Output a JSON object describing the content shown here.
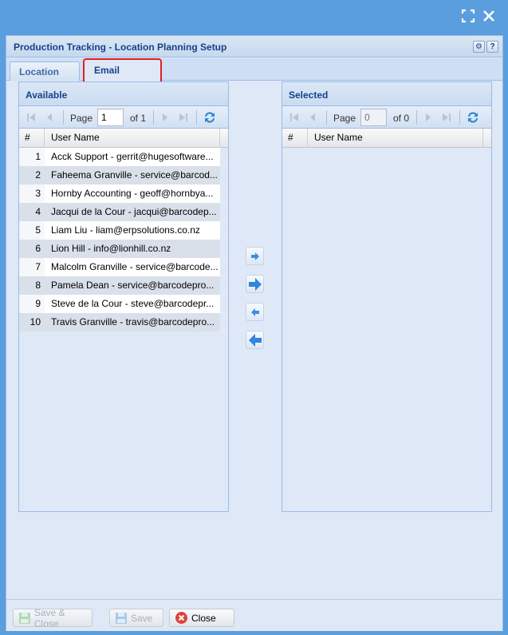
{
  "window": {
    "title": "Production Tracking - Location Planning Setup",
    "tool_gear": "⚙",
    "tool_help": "?"
  },
  "tabs": [
    {
      "label": "Location",
      "active": false
    },
    {
      "label": "Email",
      "active": true
    }
  ],
  "available": {
    "title": "Available",
    "pager": {
      "page_label": "Page",
      "page_value": "1",
      "of_label": "of 1"
    },
    "columns": {
      "num": "#",
      "user": "User Name"
    },
    "rows": [
      {
        "num": "1",
        "name": "Acck Support - gerrit@hugesoftware..."
      },
      {
        "num": "2",
        "name": "Faheema Granville - service@barcod..."
      },
      {
        "num": "3",
        "name": "Hornby Accounting - geoff@hornbya..."
      },
      {
        "num": "4",
        "name": "Jacqui de la Cour - jacqui@barcodep..."
      },
      {
        "num": "5",
        "name": "Liam Liu - liam@erpsolutions.co.nz"
      },
      {
        "num": "6",
        "name": "Lion Hill - info@lionhill.co.nz"
      },
      {
        "num": "7",
        "name": "Malcolm Granville - service@barcode..."
      },
      {
        "num": "8",
        "name": "Pamela Dean - service@barcodepro..."
      },
      {
        "num": "9",
        "name": "Steve de la Cour - steve@barcodepr..."
      },
      {
        "num": "10",
        "name": "Travis Granville - travis@barcodepro..."
      }
    ]
  },
  "selected": {
    "title": "Selected",
    "pager": {
      "page_label": "Page",
      "page_placeholder": "0",
      "of_label": "of 0"
    },
    "columns": {
      "num": "#",
      "user": "User Name"
    }
  },
  "footer": {
    "save_close_label": "Save & Close",
    "save_label": "Save",
    "close_label": "Close"
  },
  "colors": {
    "background": "#5b9ede",
    "panel": "#dfe8f6",
    "title_text": "#15428b",
    "tab_highlight": "#e02020",
    "close_icon": "#e0413b"
  }
}
